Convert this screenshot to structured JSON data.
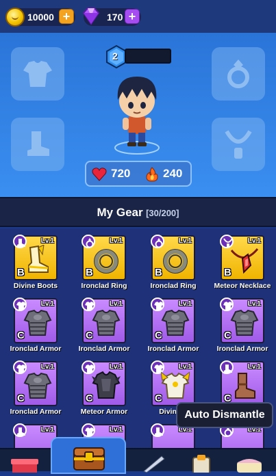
{
  "currency": {
    "coins": "10000",
    "gems": "170",
    "coin_add_label": "+",
    "gem_add_label": "+"
  },
  "hero": {
    "level": "2",
    "hp": "720",
    "attack": "240"
  },
  "equip_slots": [
    {
      "icon": "armor-slot-icon"
    },
    {
      "icon": "boots-slot-icon"
    },
    {
      "icon": "ring-slot-icon"
    },
    {
      "icon": "necklace-slot-icon"
    }
  ],
  "gear": {
    "title": "My Gear",
    "count": "[30/200]",
    "items": [
      {
        "name": "Divine Boots",
        "level": "Lv.1",
        "grade": "B",
        "rarity": "yellow",
        "category": "boots",
        "art": "boots"
      },
      {
        "name": "Ironclad Ring",
        "level": "Lv.1",
        "grade": "B",
        "rarity": "yellow",
        "category": "ring",
        "art": "ring"
      },
      {
        "name": "Ironclad Ring",
        "level": "Lv.1",
        "grade": "B",
        "rarity": "yellow",
        "category": "ring",
        "art": "ring"
      },
      {
        "name": "Meteor Necklace",
        "level": "Lv.1",
        "grade": "B",
        "rarity": "yellow",
        "category": "necklace",
        "art": "necklace"
      },
      {
        "name": "Ironclad Armor",
        "level": "Lv.1",
        "grade": "C",
        "rarity": "purple",
        "category": "armor",
        "art": "armor"
      },
      {
        "name": "Ironclad Armor",
        "level": "Lv.1",
        "grade": "C",
        "rarity": "purple",
        "category": "armor",
        "art": "armor"
      },
      {
        "name": "Ironclad Armor",
        "level": "Lv.1",
        "grade": "C",
        "rarity": "purple",
        "category": "armor",
        "art": "armor"
      },
      {
        "name": "Ironclad Armor",
        "level": "Lv.1",
        "grade": "C",
        "rarity": "purple",
        "category": "armor",
        "art": "armor"
      },
      {
        "name": "Ironclad Armor",
        "level": "Lv.1",
        "grade": "C",
        "rarity": "purple",
        "category": "armor",
        "art": "armor"
      },
      {
        "name": "Meteor Armor",
        "level": "Lv.1",
        "grade": "C",
        "rarity": "purple",
        "category": "armor",
        "art": "dark-armor"
      },
      {
        "name": "Divine A",
        "level": "Lv.1",
        "grade": "C",
        "rarity": "purple",
        "category": "armor",
        "art": "white-armor"
      },
      {
        "name": "",
        "level": "Lv.1",
        "grade": "C",
        "rarity": "purple",
        "category": "boots",
        "art": "boots-brown"
      },
      {
        "name": "",
        "level": "Lv.1",
        "grade": "",
        "rarity": "purple",
        "category": "boots",
        "art": "none"
      },
      {
        "name": "",
        "level": "Lv.1",
        "grade": "",
        "rarity": "purple",
        "category": "armor",
        "art": "none"
      },
      {
        "name": "",
        "level": "Lv.1",
        "grade": "",
        "rarity": "purple",
        "category": "boots",
        "art": "none"
      },
      {
        "name": "",
        "level": "Lv.1",
        "grade": "",
        "rarity": "purple",
        "category": "ring",
        "art": "none"
      }
    ]
  },
  "tooltip": {
    "auto_dismantle": "Auto Dismantle"
  },
  "bottom_tabs": [
    {
      "icon": "shop-icon"
    },
    {
      "icon": "chest-icon"
    },
    {
      "icon": "sword-icon"
    },
    {
      "icon": "clipboard-icon"
    },
    {
      "icon": "cake-icon"
    }
  ]
}
